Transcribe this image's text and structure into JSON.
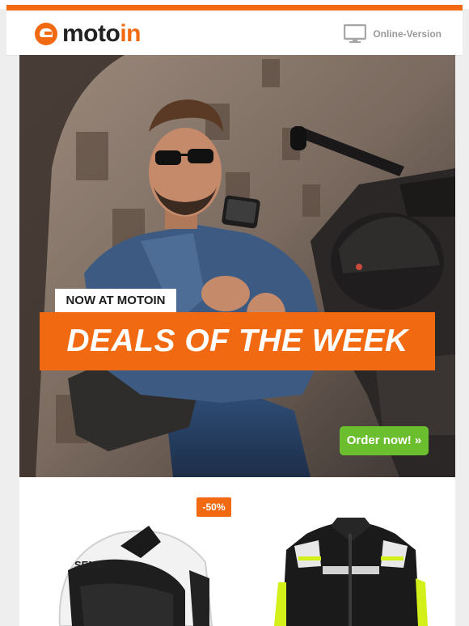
{
  "brand": {
    "name_part1": "moto",
    "name_part2": "in",
    "accent_color": "#f16a12"
  },
  "header": {
    "online_version_label": "Online-Version",
    "online_version_icon": "monitor-icon"
  },
  "hero": {
    "tag": "NOW AT MOTOIN",
    "headline": "DEALS OF THE WEEK",
    "cta_label": "Order now! »",
    "cta_color": "#6bbf2e"
  },
  "products": {
    "items": [
      {
        "name": "helmet",
        "badge": "-50%",
        "brand_print": "SENA"
      },
      {
        "name": "jacket"
      }
    ]
  }
}
